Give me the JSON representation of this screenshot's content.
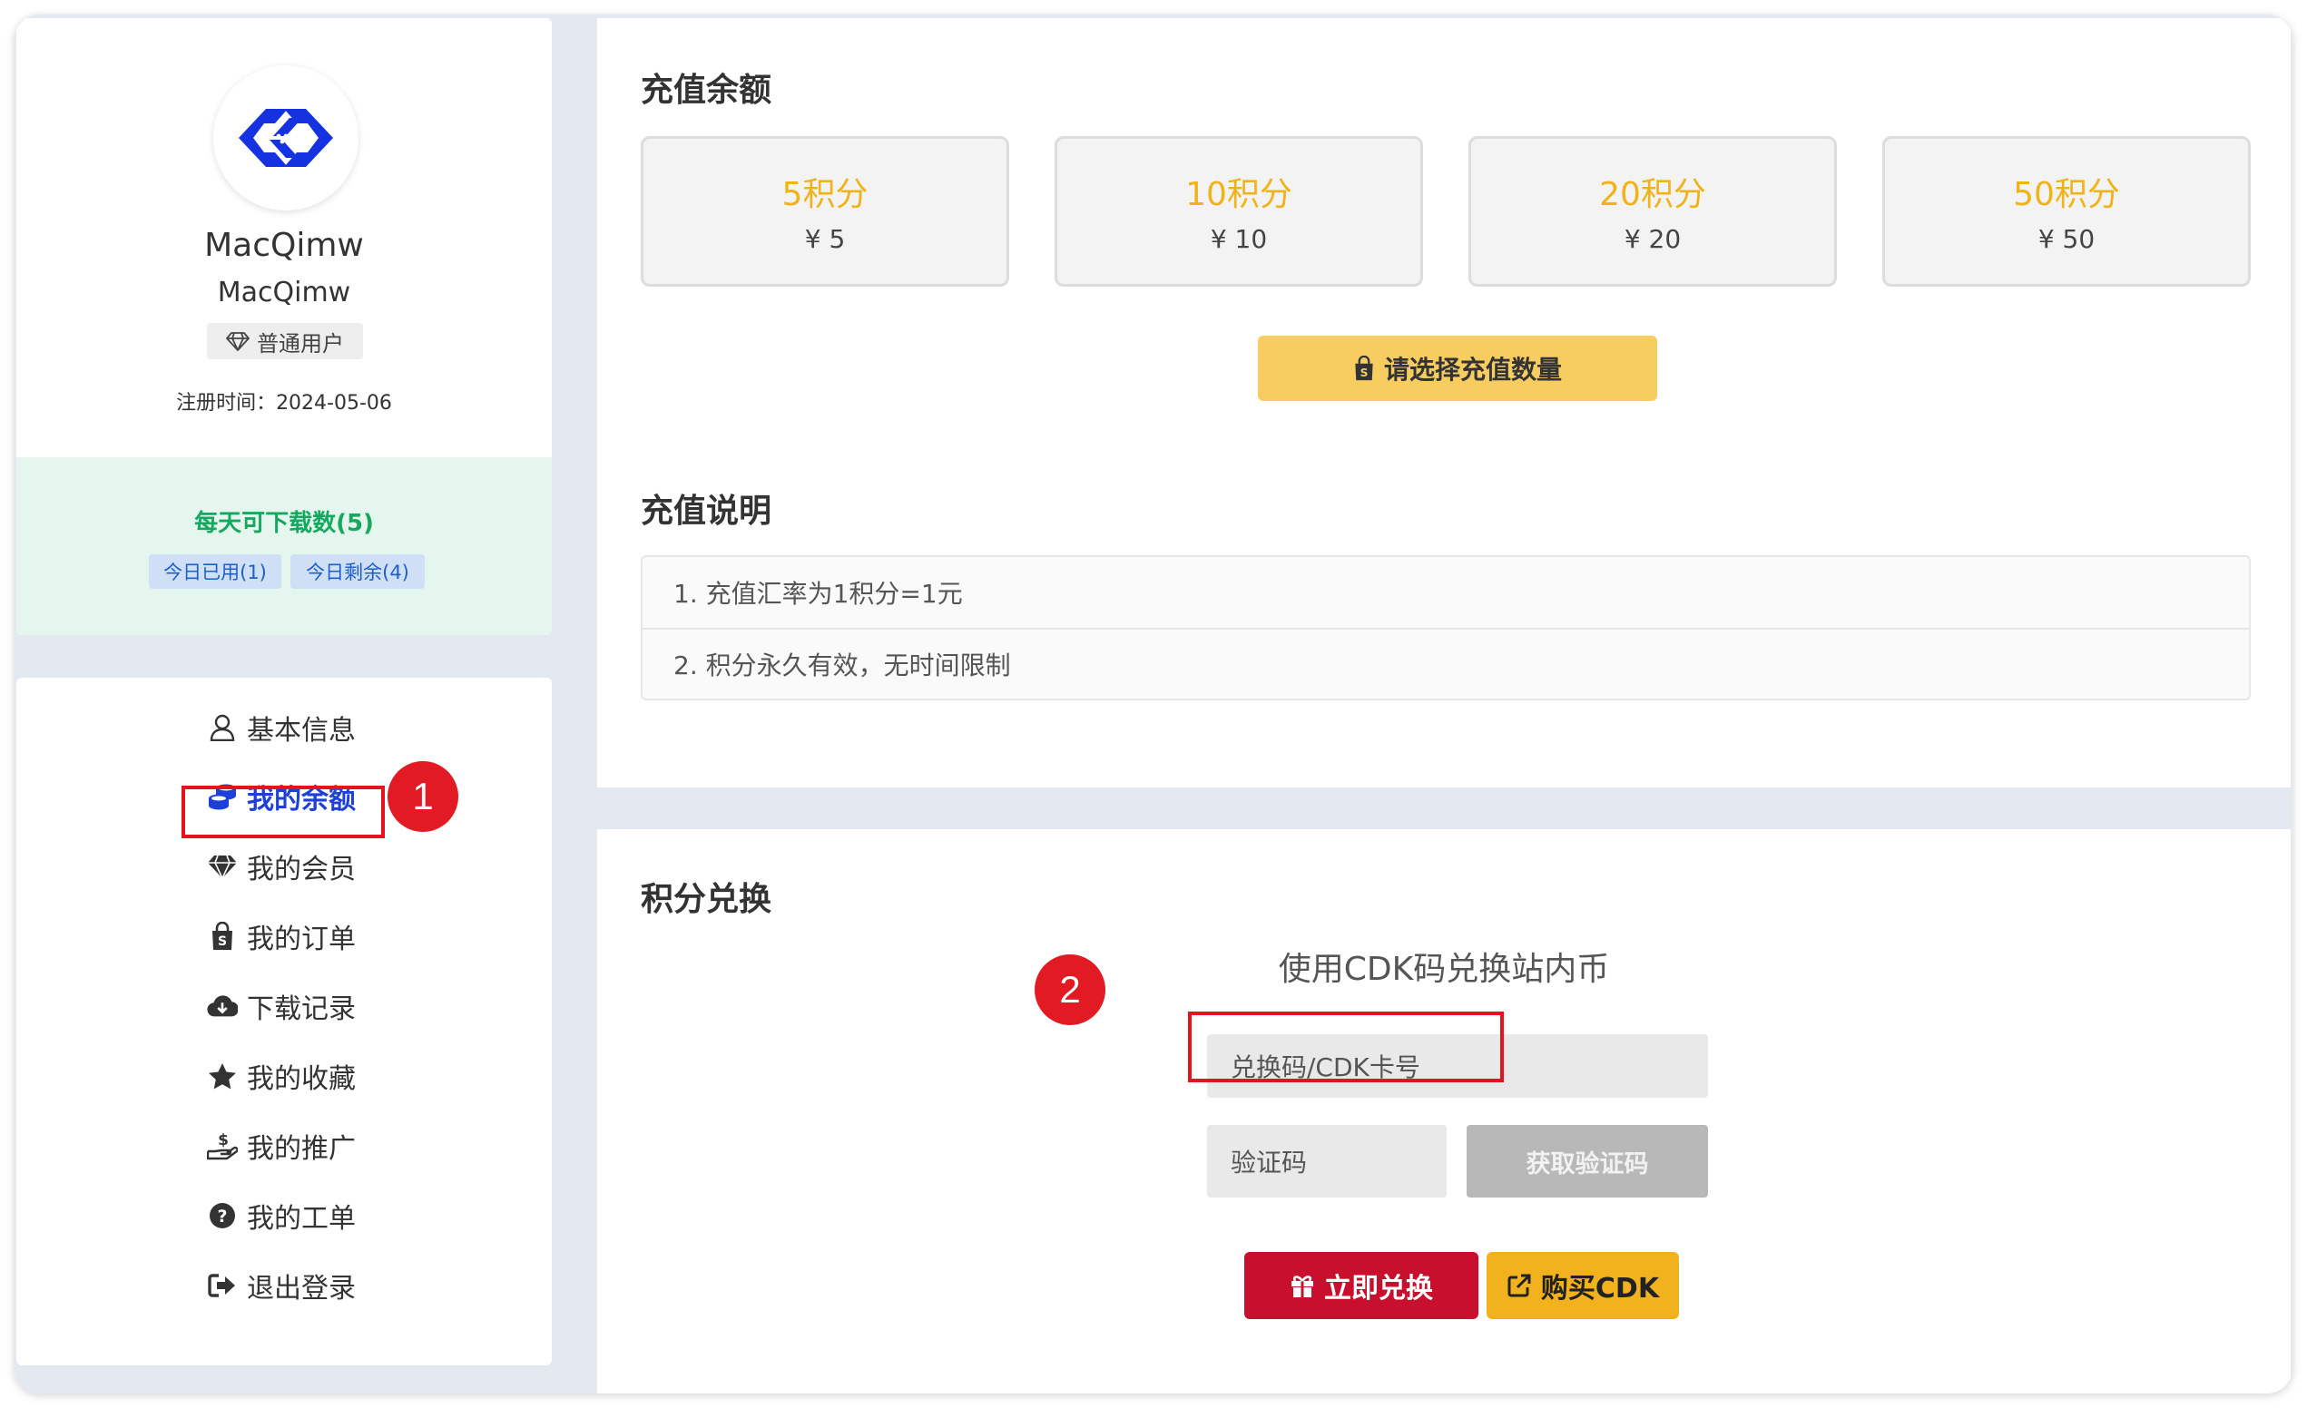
{
  "profile": {
    "name": "MacQimw",
    "username": "MacQimw",
    "role": "普通用户",
    "registered": "注册时间：2024-05-06",
    "downloads_title": "每天可下载数(5)",
    "used_today": "今日已用(1)",
    "remaining_today": "今日剩余(4)"
  },
  "menu": {
    "items": [
      {
        "label": "基本信息",
        "icon": "user-icon"
      },
      {
        "label": "我的余额",
        "icon": "coins-icon",
        "active": true
      },
      {
        "label": "我的会员",
        "icon": "diamond-icon"
      },
      {
        "label": "我的订单",
        "icon": "shopping-bag-icon"
      },
      {
        "label": "下载记录",
        "icon": "cloud-download-icon"
      },
      {
        "label": "我的收藏",
        "icon": "star-icon"
      },
      {
        "label": "我的推广",
        "icon": "hand-dollar-icon"
      },
      {
        "label": "我的工单",
        "icon": "question-circle-icon"
      },
      {
        "label": "退出登录",
        "icon": "sign-out-icon"
      }
    ]
  },
  "annotations": {
    "badge1": "1",
    "badge2": "2",
    "highlight_color": "#e5131e"
  },
  "recharge": {
    "title": "充值余额",
    "options": [
      {
        "points": "5积分",
        "price": "¥ 5"
      },
      {
        "points": "10积分",
        "price": "¥ 10"
      },
      {
        "points": "20积分",
        "price": "¥ 20"
      },
      {
        "points": "50积分",
        "price": "¥ 50"
      }
    ],
    "select_button": "请选择充值数量",
    "notes_title": "充值说明",
    "notes": [
      "1. 充值汇率为1积分=1元",
      "2. 积分永久有效，无时间限制"
    ]
  },
  "redeem": {
    "title": "积分兑换",
    "subtitle": "使用CDK码兑换站内币",
    "cdk_placeholder": "兑换码/CDK卡号",
    "code_placeholder": "验证码",
    "get_code_button": "获取验证码",
    "redeem_button": "立即兑换",
    "buy_button": "购买CDK"
  },
  "colors": {
    "accent_yellow": "#f0b319",
    "primary_blue": "#1e40d8",
    "danger_red": "#c8102e",
    "success_green": "#17a85f"
  }
}
